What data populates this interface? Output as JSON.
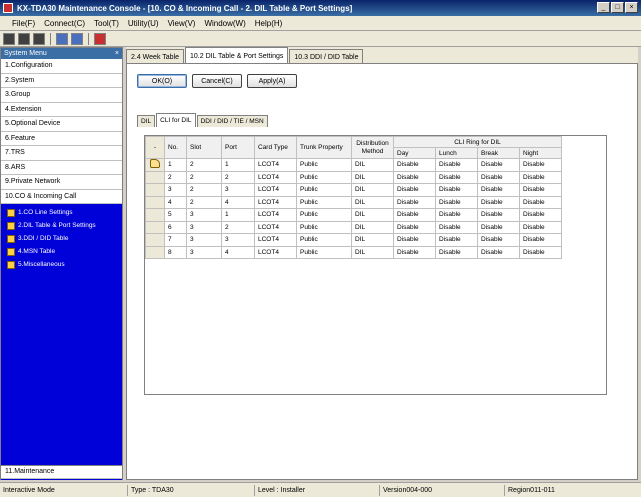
{
  "window": {
    "title": "KX-TDA30 Maintenance Console - [10. CO & Incoming Call - 2. DIL Table & Port Settings]"
  },
  "menu": [
    "File(F)",
    "Connect(C)",
    "Tool(T)",
    "Utility(U)",
    "View(V)",
    "Window(W)",
    "Help(H)"
  ],
  "sidebar": {
    "header": "System Menu",
    "items": [
      "1.Configuration",
      "2.System",
      "3.Group",
      "4.Extension",
      "5.Optional Device",
      "6.Feature",
      "7.TRS",
      "8.ARS",
      "9.Private Network",
      "10.CO & Incoming Call"
    ],
    "subitems": [
      "1.CO Line Settings",
      "2.DIL Table & Port Settings",
      "3.DDI / DID Table",
      "4.MSN Table",
      "5.Miscellaneous"
    ],
    "bottom_item": "11.Maintenance"
  },
  "top_tabs": [
    "2.4 Week Table",
    "10.2 DIL Table & Port Settings",
    "10.3 DDI / DID Table"
  ],
  "buttons": {
    "ok": "OK(O)",
    "cancel": "Cancel(C)",
    "apply": "Apply(A)"
  },
  "sub_tabs": [
    "DIL",
    "CLI for DIL",
    "DDI / DID / TIE / MSN"
  ],
  "table": {
    "sel_header": "-",
    "headers": {
      "no": "No.",
      "slot": "Slot",
      "port": "Port",
      "card_type": "Card Type",
      "trunk_property": "Trunk Property",
      "distribution": "Distribution Method",
      "cli_ring": "CLI Ring for DIL"
    },
    "ring_headers": [
      "Day",
      "Lunch",
      "Break",
      "Night"
    ],
    "rows": [
      [
        "1",
        "2",
        "1",
        "LCOT4",
        "Public",
        "DIL",
        "Disable",
        "Disable",
        "Disable",
        "Disable"
      ],
      [
        "2",
        "2",
        "2",
        "LCOT4",
        "Public",
        "DIL",
        "Disable",
        "Disable",
        "Disable",
        "Disable"
      ],
      [
        "3",
        "2",
        "3",
        "LCOT4",
        "Public",
        "DIL",
        "Disable",
        "Disable",
        "Disable",
        "Disable"
      ],
      [
        "4",
        "2",
        "4",
        "LCOT4",
        "Public",
        "DIL",
        "Disable",
        "Disable",
        "Disable",
        "Disable"
      ],
      [
        "5",
        "3",
        "1",
        "LCOT4",
        "Public",
        "DIL",
        "Disable",
        "Disable",
        "Disable",
        "Disable"
      ],
      [
        "6",
        "3",
        "2",
        "LCOT4",
        "Public",
        "DIL",
        "Disable",
        "Disable",
        "Disable",
        "Disable"
      ],
      [
        "7",
        "3",
        "3",
        "LCOT4",
        "Public",
        "DIL",
        "Disable",
        "Disable",
        "Disable",
        "Disable"
      ],
      [
        "8",
        "3",
        "4",
        "LCOT4",
        "Public",
        "DIL",
        "Disable",
        "Disable",
        "Disable",
        "Disable"
      ]
    ]
  },
  "status": {
    "mode": "Interactive Mode",
    "type": "Type : TDA30",
    "level": "Level : Installer",
    "version": "Version004-000",
    "region": "Region011-011"
  }
}
